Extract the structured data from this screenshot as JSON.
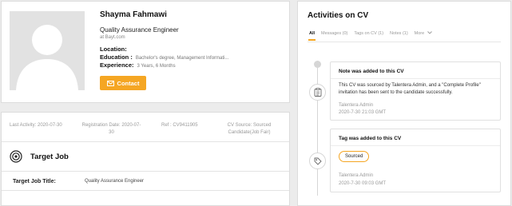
{
  "profile": {
    "name": "Shayma Fahmawi",
    "job_title": "Quality Assurance Engineer",
    "source": "at Bayt.com",
    "location_label": "Location:",
    "location_value": "",
    "education_label": "Education :",
    "education_value": "Bachelor's degree, Management Informati...",
    "experience_label": "Experience:",
    "experience_value": "3 Years, 6 Months",
    "contact_label": "Contact",
    "accent_color": "#f5a623"
  },
  "meta": {
    "last_activity": "Last Activity:  2020-07-30",
    "registration": "Registration Date:  2020-07-30",
    "ref": "Ref :  CV9411905",
    "cv_source": "CV Source:  Sourced Candidate(Job Fair)"
  },
  "target_job": {
    "heading": "Target Job",
    "title_label": "Target Job Title:",
    "title_value": "Quality Assurance Engineer"
  },
  "activities": {
    "title": "Activities on CV",
    "tabs": [
      {
        "label": "All",
        "active": true
      },
      {
        "label": "Messages (0)",
        "active": false
      },
      {
        "label": "Tags on CV (1)",
        "active": false
      },
      {
        "label": "Notes (1)",
        "active": false
      },
      {
        "label": "More",
        "active": false
      }
    ],
    "entries": [
      {
        "title": "Note was added to this CV",
        "body": "This CV was sourced by Talentera Admin, and a \"Complete Profile\" invitation has been sent to the candidate successfully.",
        "author": "Talentera Admin",
        "date": "2020-7-30 21:03 GMT",
        "icon": "clipboard-icon"
      },
      {
        "title": "Tag was added to this CV",
        "tag": "Sourced",
        "author": "Talentera Admin",
        "date": "2020-7-30 09:03 GMT",
        "icon": "tag-icon"
      }
    ]
  }
}
